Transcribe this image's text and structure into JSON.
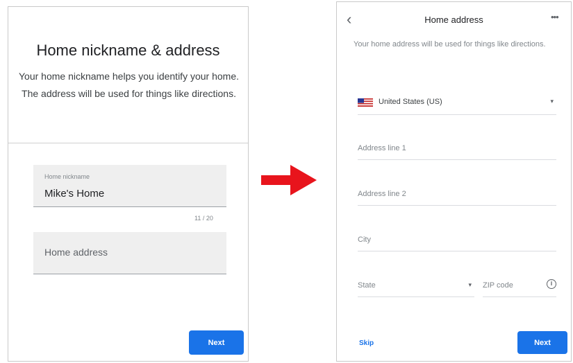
{
  "left_screen": {
    "title": "Home nickname & address",
    "description": "Your home nickname helps you identify your home. The address will be used for things like directions.",
    "nickname_field": {
      "label": "Home nickname",
      "value": "Mike's Home",
      "counter": "11 / 20"
    },
    "address_field": {
      "placeholder": "Home address"
    },
    "next_button": "Next"
  },
  "right_screen": {
    "title": "Home address",
    "more_icon": "more-horiz-icon",
    "back_icon": "chevron-left-icon",
    "description": "Your home address will be used for things like directions.",
    "country": {
      "label": "United States (US)",
      "flag": "us-flag-icon"
    },
    "fields": {
      "address_line_1": "Address line 1",
      "address_line_2": "Address line 2",
      "city": "City",
      "state": "State",
      "zip": "ZIP code"
    },
    "skip_label": "Skip",
    "next_button": "Next"
  },
  "colors": {
    "accent": "#1a73e8",
    "arrow": "#e8141c",
    "field_bg": "#efefef"
  }
}
